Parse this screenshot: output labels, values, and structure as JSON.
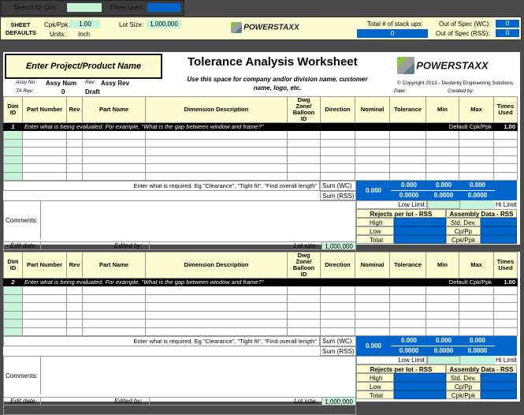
{
  "top": {
    "search_label": "Search for Dim:",
    "search_value": "",
    "times_used_label": "Times used:",
    "times_used_value": ""
  },
  "defaults": {
    "sheet_defaults": "SHEET DEFAULTS",
    "cpk_label": "Cpk/Ppk:",
    "cpk_value": "1.00",
    "units_label": "Units:",
    "units_value": "Inch",
    "lot_size_label": "Lot Size:",
    "lot_size_value": "1,000,000",
    "total_stackups_label": "Total # of stack ups:",
    "total_stackups_value": "0",
    "oos_wc_label": "Out of Spec (WC):",
    "oos_wc_value": "0",
    "oos_rss_label": "Out of Spec (RSS):",
    "oos_rss_value": "0"
  },
  "brand": {
    "name": "POWERSTAXX",
    "tm": "™"
  },
  "header": {
    "project_name": "Enter Project/Product Name",
    "title": "Tolerance Analysis Worksheet",
    "subtitle": "Use this space for company and/or division name, customer name, logo, etc.",
    "copyright": "© Copyright 2013 - Dexterity Engineering Solutions",
    "assy_no_label": "Assy No:",
    "assy_num": "Assy Num",
    "rev_label": "Rev:",
    "assy_rev": "Assy Rev",
    "ta_rev_label": "TA Rev:",
    "ta_rev_value": "0",
    "draft": "Draft",
    "date_label": "Date:",
    "created_by_label": "Created by:"
  },
  "columns": [
    "Dim ID",
    "Part Number",
    "Rev",
    "Part Name",
    "Dimension Description",
    "Dwg Zone/ Balloon ID",
    "Direction",
    "Nominal",
    "Tolerance",
    "Min",
    "Max",
    "Times Used"
  ],
  "stacks": [
    {
      "num": "1",
      "prompt": "Enter what is being evaluated. For example, \"What is the gap between window and frame?\"",
      "cpk_label": "Default Cpk/Ppk",
      "cpk_value": "1.00",
      "required": "Enter what is required. Eg \"Clearance\", \"Tight fit\", \"Find overall length\"",
      "sum_wc_label": "Sum (WC)",
      "sum_rss_label": "Sum (RSS)",
      "nominal_sum": "0.000",
      "wc_tol": "0.000",
      "wc_min": "0.000",
      "wc_max": "0.000",
      "rss_tol": "0.0000",
      "rss_min": "0.0000",
      "rss_max": "0.0000",
      "low_limit": "Low Limit",
      "hi_limit": "Hi Limit",
      "comments_label": "Comments:",
      "rejects_label": "Rejects per lot - RSS",
      "assembly_label": "Assembly Data - RSS",
      "high": "High",
      "low": "Low",
      "total": "Total",
      "std_dev": "Std. Dev.",
      "cp_pp": "Cp/Pp",
      "cpk_ppk": "Cpk/Ppk",
      "edit_date": "Edit date:",
      "edited_by": "Edited by:",
      "lot_size_label": "Lot size:",
      "lot_size_value": "1,000,000"
    },
    {
      "num": "2",
      "prompt": "Enter what is being evaluated. For example, \"What is the gap between window and frame?\"",
      "cpk_label": "Default Cpk/Ppk",
      "cpk_value": "1.00",
      "required": "Enter what is required. Eg \"Clearance\", \"Tight fit\", \"Find overall length\"",
      "sum_wc_label": "Sum (WC)",
      "sum_rss_label": "Sum (RSS)",
      "nominal_sum": "0.000",
      "wc_tol": "0.000",
      "wc_min": "0.000",
      "wc_max": "0.000",
      "rss_tol": "0.0000",
      "rss_min": "0.0000",
      "rss_max": "0.0000",
      "low_limit": "Low Limit",
      "hi_limit": "Hi Limit",
      "comments_label": "Comments:",
      "rejects_label": "Rejects per lot - RSS",
      "assembly_label": "Assembly Data - RSS",
      "high": "High",
      "low": "Low",
      "total": "Total",
      "std_dev": "Std. Dev.",
      "cp_pp": "Cp/Pp",
      "cpk_ppk": "Cpk/Ppk",
      "edit_date": "Edit date:",
      "edited_by": "Edited by:",
      "lot_size_label": "Lot size:",
      "lot_size_value": "1,000,000"
    }
  ],
  "colors": {
    "accent_blue": "#0066cc",
    "cream": "#fdfbd0",
    "light_green": "#c6f3d9"
  }
}
